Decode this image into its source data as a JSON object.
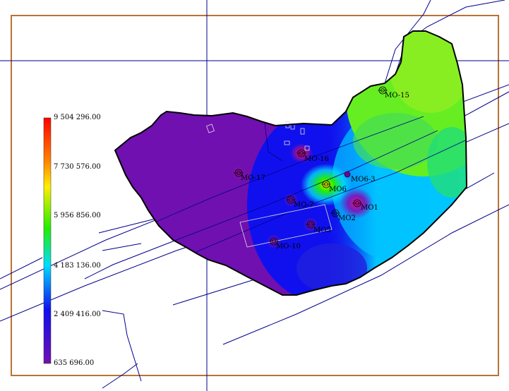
{
  "legend": {
    "ticks": [
      "9 504 296.00",
      "7 730 576.00",
      "5 956 856.00",
      "4 183 136.00",
      "2 409 416.00",
      "635 696.00"
    ],
    "colors": [
      "#ff0000",
      "#ffee00",
      "#22ee00",
      "#00ddff",
      "#1010ee",
      "#7010b0"
    ]
  },
  "wells": [
    {
      "name": "MO-15"
    },
    {
      "name": "MO-16"
    },
    {
      "name": "MO-17"
    },
    {
      "name": "MO6-3"
    },
    {
      "name": "MO6"
    },
    {
      "name": "MO-7"
    },
    {
      "name": "MO1"
    },
    {
      "name": "MO2"
    },
    {
      "name": "MO5"
    },
    {
      "name": "MO-10"
    }
  ],
  "colors": {
    "frame": "#b87333",
    "basemap_lines": "#00008b",
    "outline": "#000000"
  }
}
